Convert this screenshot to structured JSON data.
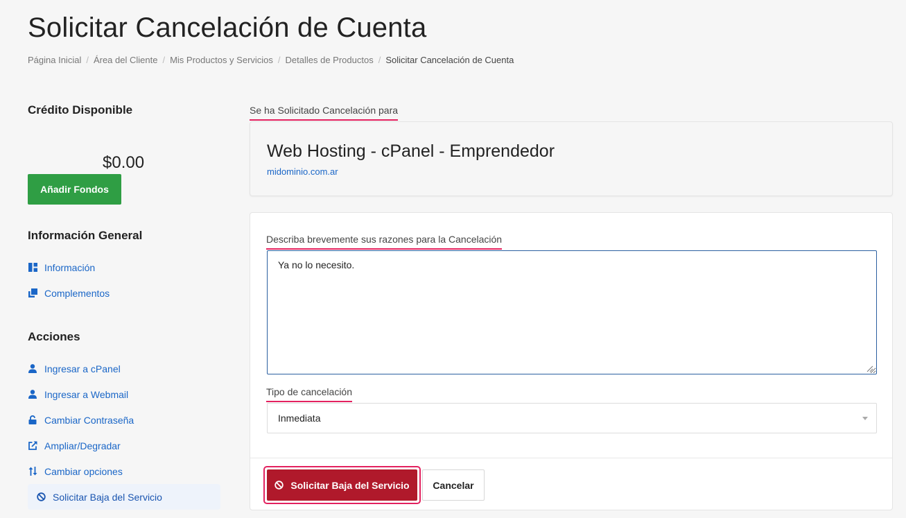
{
  "page": {
    "title": "Solicitar Cancelación de Cuenta"
  },
  "breadcrumb": [
    "Página Inicial",
    "Área del Cliente",
    "Mis Productos y Servicios",
    "Detalles de Productos",
    "Solicitar Cancelación de Cuenta"
  ],
  "sidebar": {
    "credit": {
      "heading": "Crédito Disponible",
      "amount": "$0.00",
      "button": "Añadir Fondos"
    },
    "general": {
      "heading": "Información General",
      "items": [
        {
          "label": "Información",
          "icon": "dashboard-icon"
        },
        {
          "label": "Complementos",
          "icon": "addons-icon"
        }
      ]
    },
    "actions": {
      "heading": "Acciones",
      "items": [
        {
          "label": "Ingresar a cPanel",
          "icon": "user-icon"
        },
        {
          "label": "Ingresar a Webmail",
          "icon": "user-icon"
        },
        {
          "label": "Cambiar Contraseña",
          "icon": "lock-icon"
        },
        {
          "label": "Ampliar/Degradar",
          "icon": "external-link-icon"
        },
        {
          "label": "Cambiar opciones",
          "icon": "sort-arrows-icon"
        },
        {
          "label": "Solicitar Baja del Servicio",
          "icon": "ban-icon",
          "active": true
        }
      ]
    }
  },
  "main": {
    "requested_label": "Se ha Solicitado Cancelación para",
    "product": {
      "name": "Web Hosting - cPanel - Emprendedor",
      "domain": "midominio.com.ar"
    },
    "form": {
      "reason_label": "Describa brevemente sus razones para la Cancelación",
      "reason_value": "Ya no lo necesito.",
      "type_label": "Tipo de cancelación",
      "type_value": "Inmediata",
      "submit_label": "Solicitar Baja del Servicio",
      "cancel_label": "Cancelar"
    }
  },
  "colors": {
    "link": "#1a66c7",
    "green_button": "#2f9e44",
    "red_button": "#b0192b",
    "highlight_underline": "#e3215f"
  }
}
